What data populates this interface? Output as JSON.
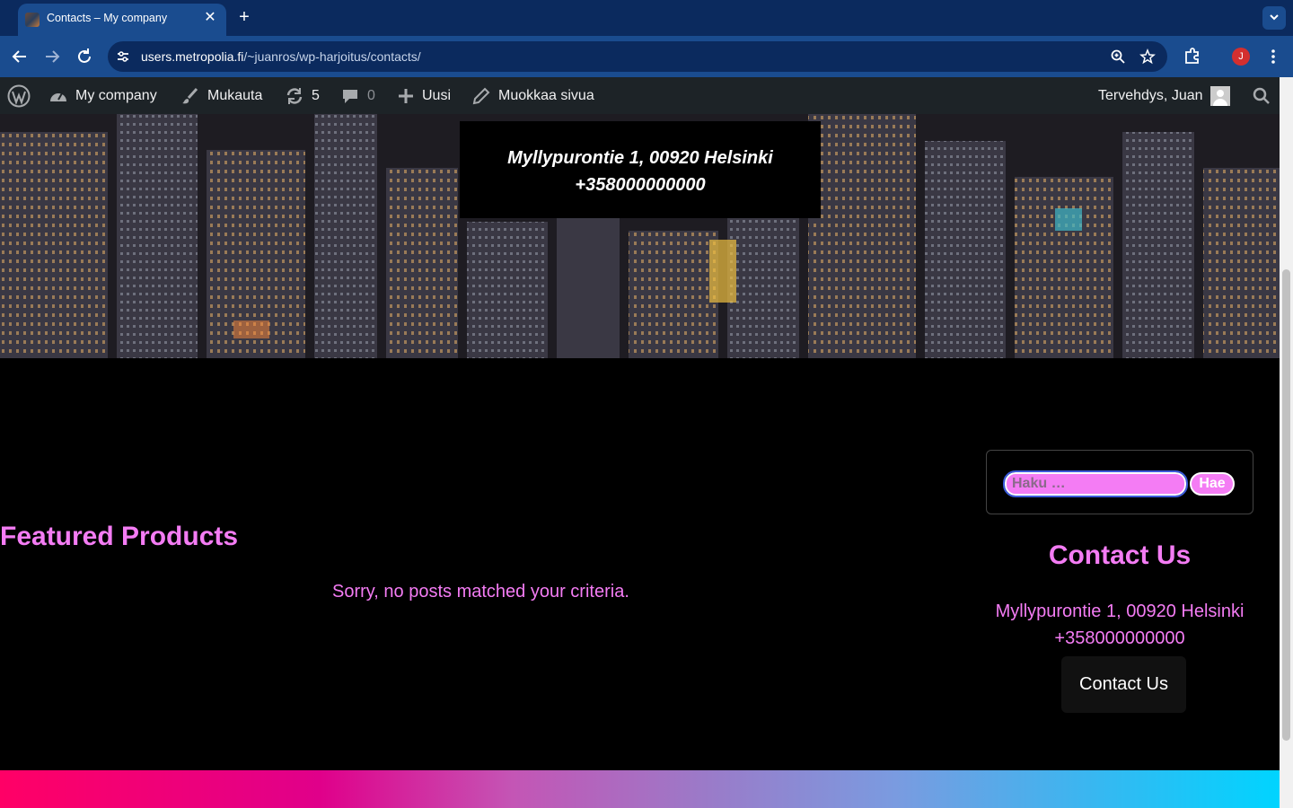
{
  "browser": {
    "tab_title": "Contacts – My company",
    "url_host": "users.metropolia.fi",
    "url_path": "/~juanros/wp-harjoitus/contacts/",
    "profile_initial": "J"
  },
  "adminbar": {
    "site_name": "My company",
    "customize": "Mukauta",
    "updates_count": "5",
    "comments_count": "0",
    "new": "Uusi",
    "edit_page": "Muokkaa sivua",
    "greeting": "Tervehdys, Juan"
  },
  "hero": {
    "address": "Myllypurontie 1, 00920 Helsinki",
    "phone": "+358000000000"
  },
  "main": {
    "featured_heading": "Featured Products",
    "no_posts": "Sorry, no posts matched your criteria."
  },
  "sidebar": {
    "search_placeholder": "Haku …",
    "search_button": "Hae",
    "contact_heading": "Contact Us",
    "address": "Myllypurontie 1, 00920 Helsinki",
    "phone": "+358000000000",
    "contact_button": "Contact Us"
  },
  "colors": {
    "accent_pink": "#f47cf4",
    "adminbar_bg": "#1d2327",
    "browser_tab_bg": "#0b2a5e",
    "browser_toolbar_bg": "#1a4c8f"
  }
}
